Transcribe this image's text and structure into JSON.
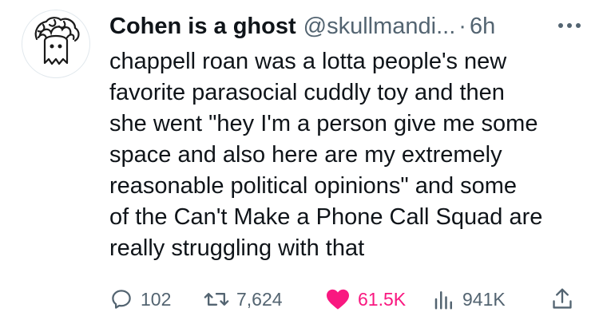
{
  "author": {
    "display_name": "Cohen is a ghost",
    "handle": "@skullmandi...",
    "separator": "·",
    "time": "6h"
  },
  "tweet": {
    "text": "chappell roan was a lotta people's new\nfavorite parasocial cuddly toy and then\nshe went \"hey I'm a person give me some\nspace and also here are my extremely\nreasonable political opinions\" and some\nof the Can't Make a Phone Call Squad are\nreally struggling with that"
  },
  "actions": {
    "replies": "102",
    "retweets": "7,624",
    "likes": "61.5K",
    "views": "941K"
  },
  "colors": {
    "text": "#0f1419",
    "muted": "#536471",
    "like": "#f91880",
    "icon": "#536471"
  },
  "icons": {
    "avatar": "ghost-doodle",
    "more": "more-icon",
    "reply": "reply-icon",
    "retweet": "retweet-icon",
    "like": "heart-icon",
    "views": "views-icon",
    "share": "share-icon"
  }
}
